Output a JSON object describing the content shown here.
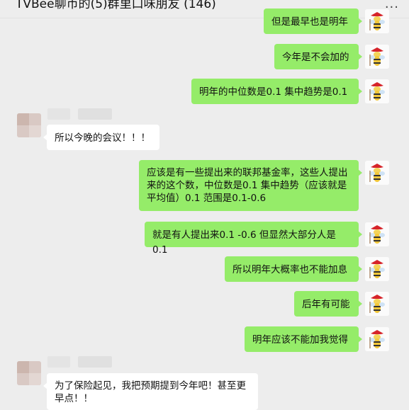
{
  "window": {
    "title": "TVBee聊币的(5)群里口味朋友 (146)",
    "more_icon": "more-dots-icon"
  },
  "messages": [
    {
      "from": "me",
      "text": "但是最早也是明年"
    },
    {
      "from": "me",
      "text": "今年是不会加的"
    },
    {
      "from": "me",
      "text": "明年的中位数是0.1 集中趋势是0.1"
    },
    {
      "from": "other",
      "text": "所以今晚的会议！！！"
    },
    {
      "from": "me",
      "text": "应该是有一些提出来的联邦基金率，这些人提出来的这个数，中位数是0.1 集中趋势（应该就是平均值）0.1 范围是0.1-0.6"
    },
    {
      "from": "me",
      "text": "就是有人提出来0.1 -0.6 但显然大部分人是0.1"
    },
    {
      "from": "me",
      "text": "所以明年大概率也不能加息"
    },
    {
      "from": "me",
      "text": "后年有可能"
    },
    {
      "from": "me",
      "text": "明年应该不能加我觉得"
    },
    {
      "from": "other",
      "text": "为了保险起见，我把预期提到今年吧！甚至更早点！！"
    }
  ],
  "colors": {
    "me_bubble": "#95ec69",
    "other_bubble": "#ffffff",
    "background": "#ededed"
  }
}
